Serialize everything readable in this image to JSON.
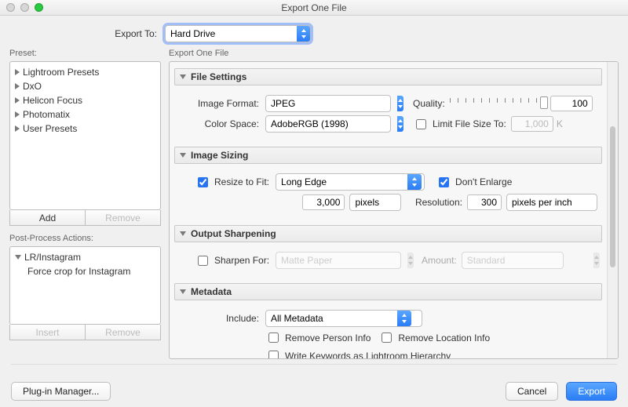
{
  "window": {
    "title": "Export One File"
  },
  "exportTo": {
    "label": "Export To:",
    "value": "Hard Drive"
  },
  "leftPane": {
    "presetLabel": "Preset:",
    "presets": [
      {
        "label": "Lightroom Presets"
      },
      {
        "label": "DxO"
      },
      {
        "label": "Helicon Focus"
      },
      {
        "label": "Photomatix"
      },
      {
        "label": "User Presets"
      }
    ],
    "addLabel": "Add",
    "removeLabel": "Remove",
    "ppaLabel": "Post-Process Actions:",
    "ppa": {
      "group": "LR/Instagram",
      "item": "Force crop for Instagram"
    },
    "insertLabel": "Insert",
    "removeLabel2": "Remove"
  },
  "rightPane": {
    "header": "Export One File",
    "fileSettings": {
      "title": "File Settings",
      "imageFormatLabel": "Image Format:",
      "imageFormat": "JPEG",
      "qualityLabel": "Quality:",
      "quality": "100",
      "colorSpaceLabel": "Color Space:",
      "colorSpace": "AdobeRGB (1998)",
      "limitLabel": "Limit File Size To:",
      "limitValue": "1,000",
      "limitUnit": "K"
    },
    "imageSizing": {
      "title": "Image Sizing",
      "resizeLabel": "Resize to Fit:",
      "resizeMode": "Long Edge",
      "dontEnlarge": "Don't Enlarge",
      "sizeValue": "3,000",
      "sizeUnit": "pixels",
      "resolutionLabel": "Resolution:",
      "resolutionValue": "300",
      "resolutionUnit": "pixels per inch"
    },
    "sharpen": {
      "title": "Output Sharpening",
      "sharpenForLabel": "Sharpen For:",
      "media": "Matte Paper",
      "amountLabel": "Amount:",
      "amount": "Standard"
    },
    "metadata": {
      "title": "Metadata",
      "includeLabel": "Include:",
      "include": "All Metadata",
      "removePerson": "Remove Person Info",
      "removeLocation": "Remove Location Info",
      "writeKeywords": "Write Keywords as Lightroom Hierarchy"
    }
  },
  "bottom": {
    "pluginMgr": "Plug-in Manager...",
    "cancel": "Cancel",
    "export": "Export"
  }
}
